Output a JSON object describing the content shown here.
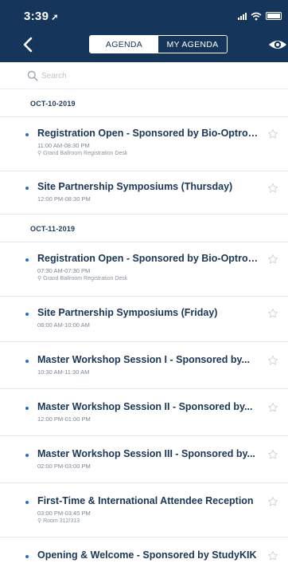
{
  "status_bar": {
    "time": "3:39",
    "location_arrow": "➚"
  },
  "nav": {
    "back_icon": "chevron-left-icon",
    "tabs": [
      {
        "label": "AGENDA",
        "active": true
      },
      {
        "label": "MY AGENDA",
        "active": false
      }
    ],
    "visibility_icon": "eye-icon"
  },
  "search": {
    "placeholder": "Search",
    "value": ""
  },
  "colors": {
    "header_bg": "#16355a",
    "text_primary": "#1a3656",
    "text_muted": "#7b8794",
    "bullet": "#2c6fb0",
    "divider": "#e6e9ed"
  },
  "days": [
    {
      "date": "OCT-10-2019",
      "sessions": [
        {
          "title": "Registration Open - Sponsored by Bio-Optronics, Inc.",
          "time": "11:00 AM-08:30 PM",
          "location": "Grand Ballroom Registration Desk"
        },
        {
          "title": "Site Partnership Symposiums (Thursday)",
          "time": "12:00 PM-08:30 PM",
          "location": ""
        }
      ]
    },
    {
      "date": "OCT-11-2019",
      "sessions": [
        {
          "title": "Registration Open - Sponsored by Bio-Optronics, Inc.",
          "time": "07:30 AM-07:30 PM",
          "location": "Grand Ballroom Registration Desk"
        },
        {
          "title": "Site Partnership Symposiums (Friday)",
          "time": "08:00 AM-10:00 AM",
          "location": ""
        },
        {
          "title": "Master Workshop Session I - Sponsored by...",
          "time": "10:30 AM-11:30 AM",
          "location": ""
        },
        {
          "title": "Master Workshop Session II - Sponsored by...",
          "time": "12:00 PM-01:00 PM",
          "location": ""
        },
        {
          "title": "Master Workshop Session III - Sponsored by...",
          "time": "02:00 PM-03:00 PM",
          "location": ""
        },
        {
          "title": "First-Time & International Attendee Reception",
          "time": "03:00 PM-03:45 PM",
          "location": "Room 312/313"
        },
        {
          "title": "Opening & Welcome - Sponsored by StudyKIK",
          "time": "",
          "location": ""
        }
      ]
    }
  ]
}
